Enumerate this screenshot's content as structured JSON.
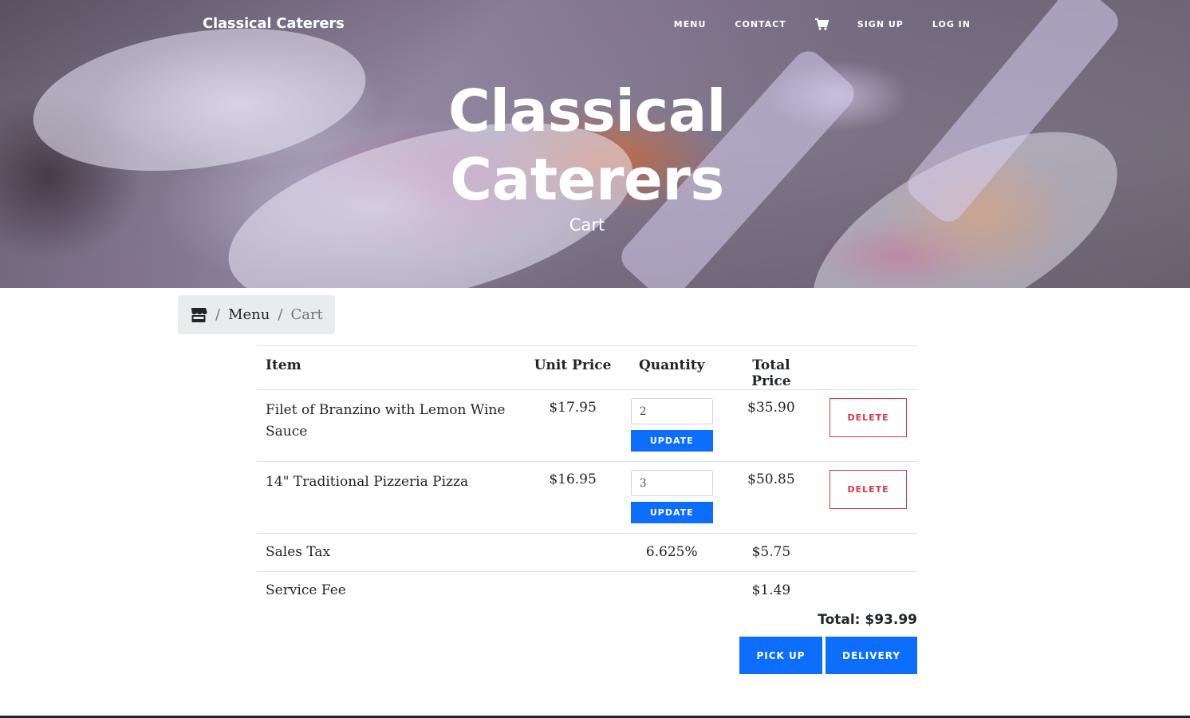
{
  "navbar": {
    "brand": "Classical Caterers",
    "links": {
      "menu": "MENU",
      "contact": "CONTACT",
      "signup": "SIGN UP",
      "login": "LOG IN"
    },
    "cart_icon": "shopping-cart-icon"
  },
  "hero": {
    "title_line1": "Classical",
    "title_line2": "Caterers",
    "subtitle": "Cart"
  },
  "breadcrumb": {
    "home_icon": "store-icon",
    "separator": "/",
    "items": [
      "Menu",
      "Cart"
    ]
  },
  "table": {
    "headers": {
      "item": "Item",
      "unit_price": "Unit Price",
      "quantity": "Quantity",
      "total_price": "Total Price"
    },
    "rows": [
      {
        "item": "Filet of Branzino with Lemon Wine Sauce",
        "unit_price": "$17.95",
        "quantity": "2",
        "total_price": "$35.90",
        "update_label": "UPDATE",
        "delete_label": "DELETE"
      },
      {
        "item": "14\" Traditional Pizzeria Pizza",
        "unit_price": "$16.95",
        "quantity": "3",
        "total_price": "$50.85",
        "update_label": "UPDATE",
        "delete_label": "DELETE"
      }
    ],
    "sales_tax": {
      "label": "Sales Tax",
      "rate": "6.625%",
      "amount": "$5.75"
    },
    "service_fee": {
      "label": "Service Fee",
      "amount": "$1.49"
    }
  },
  "summary": {
    "total": "Total: $93.99",
    "pickup_label": "PICK UP",
    "delivery_label": "DELIVERY"
  },
  "colors": {
    "primary": "#0d6efd",
    "danger": "#dc3545",
    "breadcrumb_bg": "#e9ecef"
  }
}
